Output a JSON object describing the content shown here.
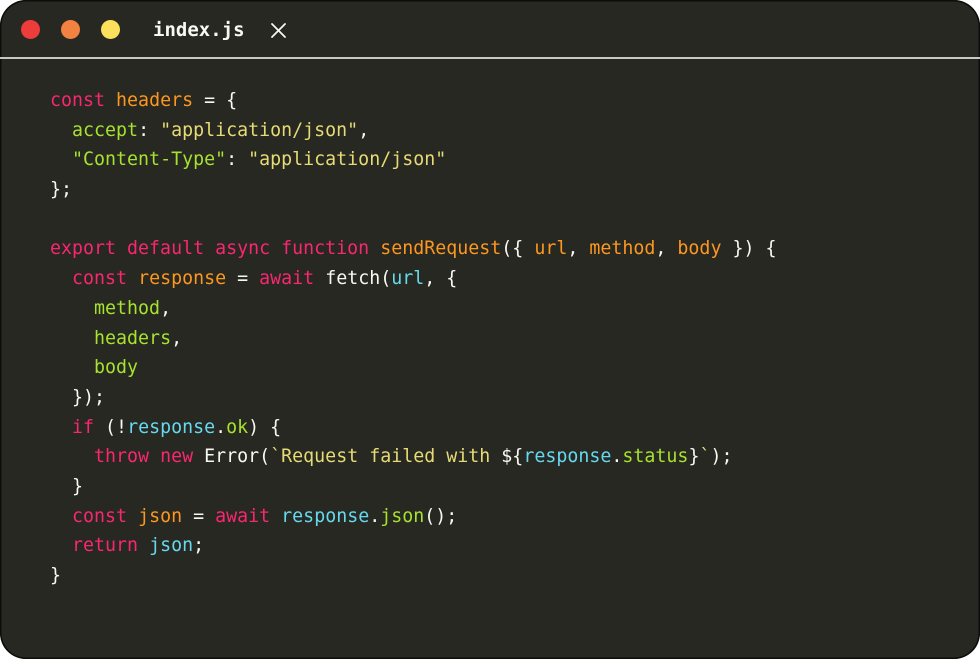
{
  "window": {
    "tab_title": "index.js",
    "traffic_lights": [
      {
        "name": "close",
        "color": "#ee3b3b"
      },
      {
        "name": "minimize",
        "color": "#f18242"
      },
      {
        "name": "maximize",
        "color": "#fce05c"
      }
    ]
  },
  "editor": {
    "language": "javascript",
    "colors": {
      "background": "#272822",
      "default": "#f8f8f2",
      "keyword": "#f92672",
      "identifier": "#fd971f",
      "property": "#a6e22e",
      "string": "#e6db74",
      "variable": "#66d9ef"
    },
    "lines": [
      [
        {
          "t": "const",
          "c": "keyword"
        },
        {
          "t": " ",
          "c": "default"
        },
        {
          "t": "headers",
          "c": "identifier"
        },
        {
          "t": " = {",
          "c": "default"
        }
      ],
      [
        {
          "t": "  ",
          "c": "default"
        },
        {
          "t": "accept",
          "c": "property"
        },
        {
          "t": ": ",
          "c": "default"
        },
        {
          "t": "\"application/json\"",
          "c": "string"
        },
        {
          "t": ",",
          "c": "default"
        }
      ],
      [
        {
          "t": "  ",
          "c": "default"
        },
        {
          "t": "\"Content-Type\"",
          "c": "property"
        },
        {
          "t": ": ",
          "c": "default"
        },
        {
          "t": "\"application/json\"",
          "c": "string"
        }
      ],
      [
        {
          "t": "};",
          "c": "default"
        }
      ],
      [],
      [
        {
          "t": "export default async function",
          "c": "keyword"
        },
        {
          "t": " ",
          "c": "default"
        },
        {
          "t": "sendRequest",
          "c": "identifier"
        },
        {
          "t": "({ ",
          "c": "default"
        },
        {
          "t": "url",
          "c": "identifier"
        },
        {
          "t": ", ",
          "c": "default"
        },
        {
          "t": "method",
          "c": "identifier"
        },
        {
          "t": ", ",
          "c": "default"
        },
        {
          "t": "body",
          "c": "identifier"
        },
        {
          "t": " }) {",
          "c": "default"
        }
      ],
      [
        {
          "t": "  ",
          "c": "default"
        },
        {
          "t": "const",
          "c": "keyword"
        },
        {
          "t": " ",
          "c": "default"
        },
        {
          "t": "response",
          "c": "identifier"
        },
        {
          "t": " = ",
          "c": "default"
        },
        {
          "t": "await",
          "c": "keyword"
        },
        {
          "t": " fetch(",
          "c": "default"
        },
        {
          "t": "url",
          "c": "variable"
        },
        {
          "t": ", {",
          "c": "default"
        }
      ],
      [
        {
          "t": "    ",
          "c": "default"
        },
        {
          "t": "method",
          "c": "property"
        },
        {
          "t": ",",
          "c": "default"
        }
      ],
      [
        {
          "t": "    ",
          "c": "default"
        },
        {
          "t": "headers",
          "c": "property"
        },
        {
          "t": ",",
          "c": "default"
        }
      ],
      [
        {
          "t": "    ",
          "c": "default"
        },
        {
          "t": "body",
          "c": "property"
        }
      ],
      [
        {
          "t": "  });",
          "c": "default"
        }
      ],
      [
        {
          "t": "  ",
          "c": "default"
        },
        {
          "t": "if",
          "c": "keyword"
        },
        {
          "t": " (!",
          "c": "default"
        },
        {
          "t": "response",
          "c": "variable"
        },
        {
          "t": ".",
          "c": "default"
        },
        {
          "t": "ok",
          "c": "property"
        },
        {
          "t": ") {",
          "c": "default"
        }
      ],
      [
        {
          "t": "    ",
          "c": "default"
        },
        {
          "t": "throw",
          "c": "keyword"
        },
        {
          "t": " ",
          "c": "default"
        },
        {
          "t": "new",
          "c": "keyword"
        },
        {
          "t": " Error(",
          "c": "default"
        },
        {
          "t": "`Request failed with ",
          "c": "string"
        },
        {
          "t": "${",
          "c": "default"
        },
        {
          "t": "response",
          "c": "variable"
        },
        {
          "t": ".",
          "c": "default"
        },
        {
          "t": "status",
          "c": "property"
        },
        {
          "t": "}",
          "c": "default"
        },
        {
          "t": "`",
          "c": "string"
        },
        {
          "t": ");",
          "c": "default"
        }
      ],
      [
        {
          "t": "  }",
          "c": "default"
        }
      ],
      [
        {
          "t": "  ",
          "c": "default"
        },
        {
          "t": "const",
          "c": "keyword"
        },
        {
          "t": " ",
          "c": "default"
        },
        {
          "t": "json",
          "c": "identifier"
        },
        {
          "t": " = ",
          "c": "default"
        },
        {
          "t": "await",
          "c": "keyword"
        },
        {
          "t": " ",
          "c": "default"
        },
        {
          "t": "response",
          "c": "variable"
        },
        {
          "t": ".",
          "c": "default"
        },
        {
          "t": "json",
          "c": "property"
        },
        {
          "t": "();",
          "c": "default"
        }
      ],
      [
        {
          "t": "  ",
          "c": "default"
        },
        {
          "t": "return",
          "c": "keyword"
        },
        {
          "t": " ",
          "c": "default"
        },
        {
          "t": "json",
          "c": "variable"
        },
        {
          "t": ";",
          "c": "default"
        }
      ],
      [
        {
          "t": "}",
          "c": "default"
        }
      ]
    ]
  }
}
